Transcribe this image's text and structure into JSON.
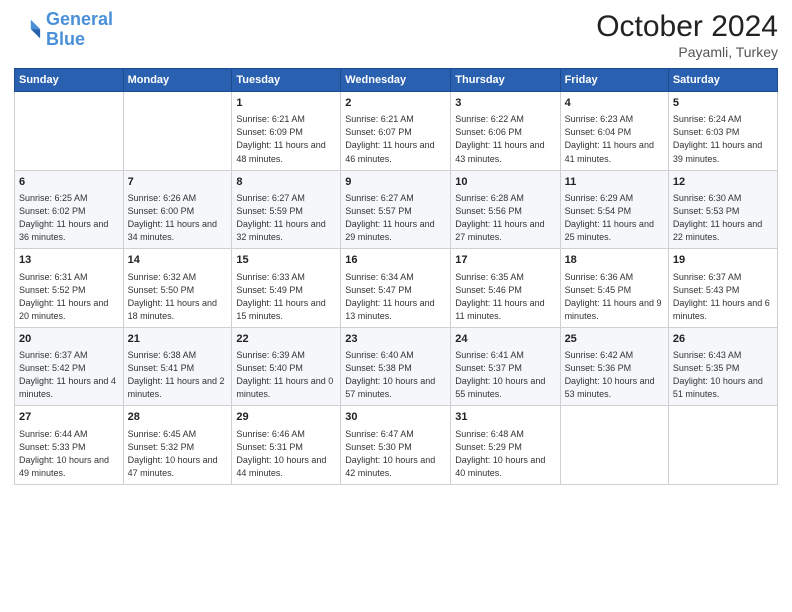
{
  "logo": {
    "line1": "General",
    "line2": "Blue"
  },
  "title": "October 2024",
  "location": "Payamli, Turkey",
  "weekdays": [
    "Sunday",
    "Monday",
    "Tuesday",
    "Wednesday",
    "Thursday",
    "Friday",
    "Saturday"
  ],
  "weeks": [
    [
      {
        "day": "",
        "sunrise": "",
        "sunset": "",
        "daylight": ""
      },
      {
        "day": "",
        "sunrise": "",
        "sunset": "",
        "daylight": ""
      },
      {
        "day": "1",
        "sunrise": "Sunrise: 6:21 AM",
        "sunset": "Sunset: 6:09 PM",
        "daylight": "Daylight: 11 hours and 48 minutes."
      },
      {
        "day": "2",
        "sunrise": "Sunrise: 6:21 AM",
        "sunset": "Sunset: 6:07 PM",
        "daylight": "Daylight: 11 hours and 46 minutes."
      },
      {
        "day": "3",
        "sunrise": "Sunrise: 6:22 AM",
        "sunset": "Sunset: 6:06 PM",
        "daylight": "Daylight: 11 hours and 43 minutes."
      },
      {
        "day": "4",
        "sunrise": "Sunrise: 6:23 AM",
        "sunset": "Sunset: 6:04 PM",
        "daylight": "Daylight: 11 hours and 41 minutes."
      },
      {
        "day": "5",
        "sunrise": "Sunrise: 6:24 AM",
        "sunset": "Sunset: 6:03 PM",
        "daylight": "Daylight: 11 hours and 39 minutes."
      }
    ],
    [
      {
        "day": "6",
        "sunrise": "Sunrise: 6:25 AM",
        "sunset": "Sunset: 6:02 PM",
        "daylight": "Daylight: 11 hours and 36 minutes."
      },
      {
        "day": "7",
        "sunrise": "Sunrise: 6:26 AM",
        "sunset": "Sunset: 6:00 PM",
        "daylight": "Daylight: 11 hours and 34 minutes."
      },
      {
        "day": "8",
        "sunrise": "Sunrise: 6:27 AM",
        "sunset": "Sunset: 5:59 PM",
        "daylight": "Daylight: 11 hours and 32 minutes."
      },
      {
        "day": "9",
        "sunrise": "Sunrise: 6:27 AM",
        "sunset": "Sunset: 5:57 PM",
        "daylight": "Daylight: 11 hours and 29 minutes."
      },
      {
        "day": "10",
        "sunrise": "Sunrise: 6:28 AM",
        "sunset": "Sunset: 5:56 PM",
        "daylight": "Daylight: 11 hours and 27 minutes."
      },
      {
        "day": "11",
        "sunrise": "Sunrise: 6:29 AM",
        "sunset": "Sunset: 5:54 PM",
        "daylight": "Daylight: 11 hours and 25 minutes."
      },
      {
        "day": "12",
        "sunrise": "Sunrise: 6:30 AM",
        "sunset": "Sunset: 5:53 PM",
        "daylight": "Daylight: 11 hours and 22 minutes."
      }
    ],
    [
      {
        "day": "13",
        "sunrise": "Sunrise: 6:31 AM",
        "sunset": "Sunset: 5:52 PM",
        "daylight": "Daylight: 11 hours and 20 minutes."
      },
      {
        "day": "14",
        "sunrise": "Sunrise: 6:32 AM",
        "sunset": "Sunset: 5:50 PM",
        "daylight": "Daylight: 11 hours and 18 minutes."
      },
      {
        "day": "15",
        "sunrise": "Sunrise: 6:33 AM",
        "sunset": "Sunset: 5:49 PM",
        "daylight": "Daylight: 11 hours and 15 minutes."
      },
      {
        "day": "16",
        "sunrise": "Sunrise: 6:34 AM",
        "sunset": "Sunset: 5:47 PM",
        "daylight": "Daylight: 11 hours and 13 minutes."
      },
      {
        "day": "17",
        "sunrise": "Sunrise: 6:35 AM",
        "sunset": "Sunset: 5:46 PM",
        "daylight": "Daylight: 11 hours and 11 minutes."
      },
      {
        "day": "18",
        "sunrise": "Sunrise: 6:36 AM",
        "sunset": "Sunset: 5:45 PM",
        "daylight": "Daylight: 11 hours and 9 minutes."
      },
      {
        "day": "19",
        "sunrise": "Sunrise: 6:37 AM",
        "sunset": "Sunset: 5:43 PM",
        "daylight": "Daylight: 11 hours and 6 minutes."
      }
    ],
    [
      {
        "day": "20",
        "sunrise": "Sunrise: 6:37 AM",
        "sunset": "Sunset: 5:42 PM",
        "daylight": "Daylight: 11 hours and 4 minutes."
      },
      {
        "day": "21",
        "sunrise": "Sunrise: 6:38 AM",
        "sunset": "Sunset: 5:41 PM",
        "daylight": "Daylight: 11 hours and 2 minutes."
      },
      {
        "day": "22",
        "sunrise": "Sunrise: 6:39 AM",
        "sunset": "Sunset: 5:40 PM",
        "daylight": "Daylight: 11 hours and 0 minutes."
      },
      {
        "day": "23",
        "sunrise": "Sunrise: 6:40 AM",
        "sunset": "Sunset: 5:38 PM",
        "daylight": "Daylight: 10 hours and 57 minutes."
      },
      {
        "day": "24",
        "sunrise": "Sunrise: 6:41 AM",
        "sunset": "Sunset: 5:37 PM",
        "daylight": "Daylight: 10 hours and 55 minutes."
      },
      {
        "day": "25",
        "sunrise": "Sunrise: 6:42 AM",
        "sunset": "Sunset: 5:36 PM",
        "daylight": "Daylight: 10 hours and 53 minutes."
      },
      {
        "day": "26",
        "sunrise": "Sunrise: 6:43 AM",
        "sunset": "Sunset: 5:35 PM",
        "daylight": "Daylight: 10 hours and 51 minutes."
      }
    ],
    [
      {
        "day": "27",
        "sunrise": "Sunrise: 6:44 AM",
        "sunset": "Sunset: 5:33 PM",
        "daylight": "Daylight: 10 hours and 49 minutes."
      },
      {
        "day": "28",
        "sunrise": "Sunrise: 6:45 AM",
        "sunset": "Sunset: 5:32 PM",
        "daylight": "Daylight: 10 hours and 47 minutes."
      },
      {
        "day": "29",
        "sunrise": "Sunrise: 6:46 AM",
        "sunset": "Sunset: 5:31 PM",
        "daylight": "Daylight: 10 hours and 44 minutes."
      },
      {
        "day": "30",
        "sunrise": "Sunrise: 6:47 AM",
        "sunset": "Sunset: 5:30 PM",
        "daylight": "Daylight: 10 hours and 42 minutes."
      },
      {
        "day": "31",
        "sunrise": "Sunrise: 6:48 AM",
        "sunset": "Sunset: 5:29 PM",
        "daylight": "Daylight: 10 hours and 40 minutes."
      },
      {
        "day": "",
        "sunrise": "",
        "sunset": "",
        "daylight": ""
      },
      {
        "day": "",
        "sunrise": "",
        "sunset": "",
        "daylight": ""
      }
    ]
  ]
}
